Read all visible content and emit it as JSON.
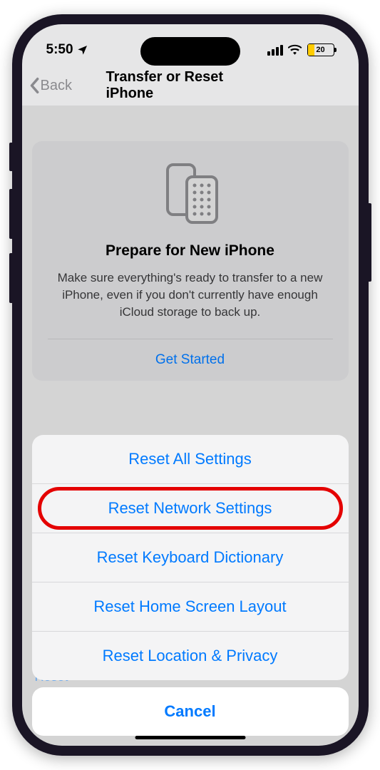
{
  "status_bar": {
    "time": "5:50",
    "battery_percent": "20"
  },
  "nav": {
    "back_label": "Back",
    "title": "Transfer or Reset iPhone"
  },
  "prepare_card": {
    "title": "Prepare for New iPhone",
    "description": "Make sure everything's ready to transfer to a new iPhone, even if you don't currently have enough iCloud storage to back up.",
    "action": "Get Started"
  },
  "background_stub": "Reset",
  "action_sheet": {
    "items": [
      "Reset All Settings",
      "Reset Network Settings",
      "Reset Keyboard Dictionary",
      "Reset Home Screen Layout",
      "Reset Location & Privacy"
    ],
    "cancel": "Cancel",
    "highlighted_index": 1
  }
}
